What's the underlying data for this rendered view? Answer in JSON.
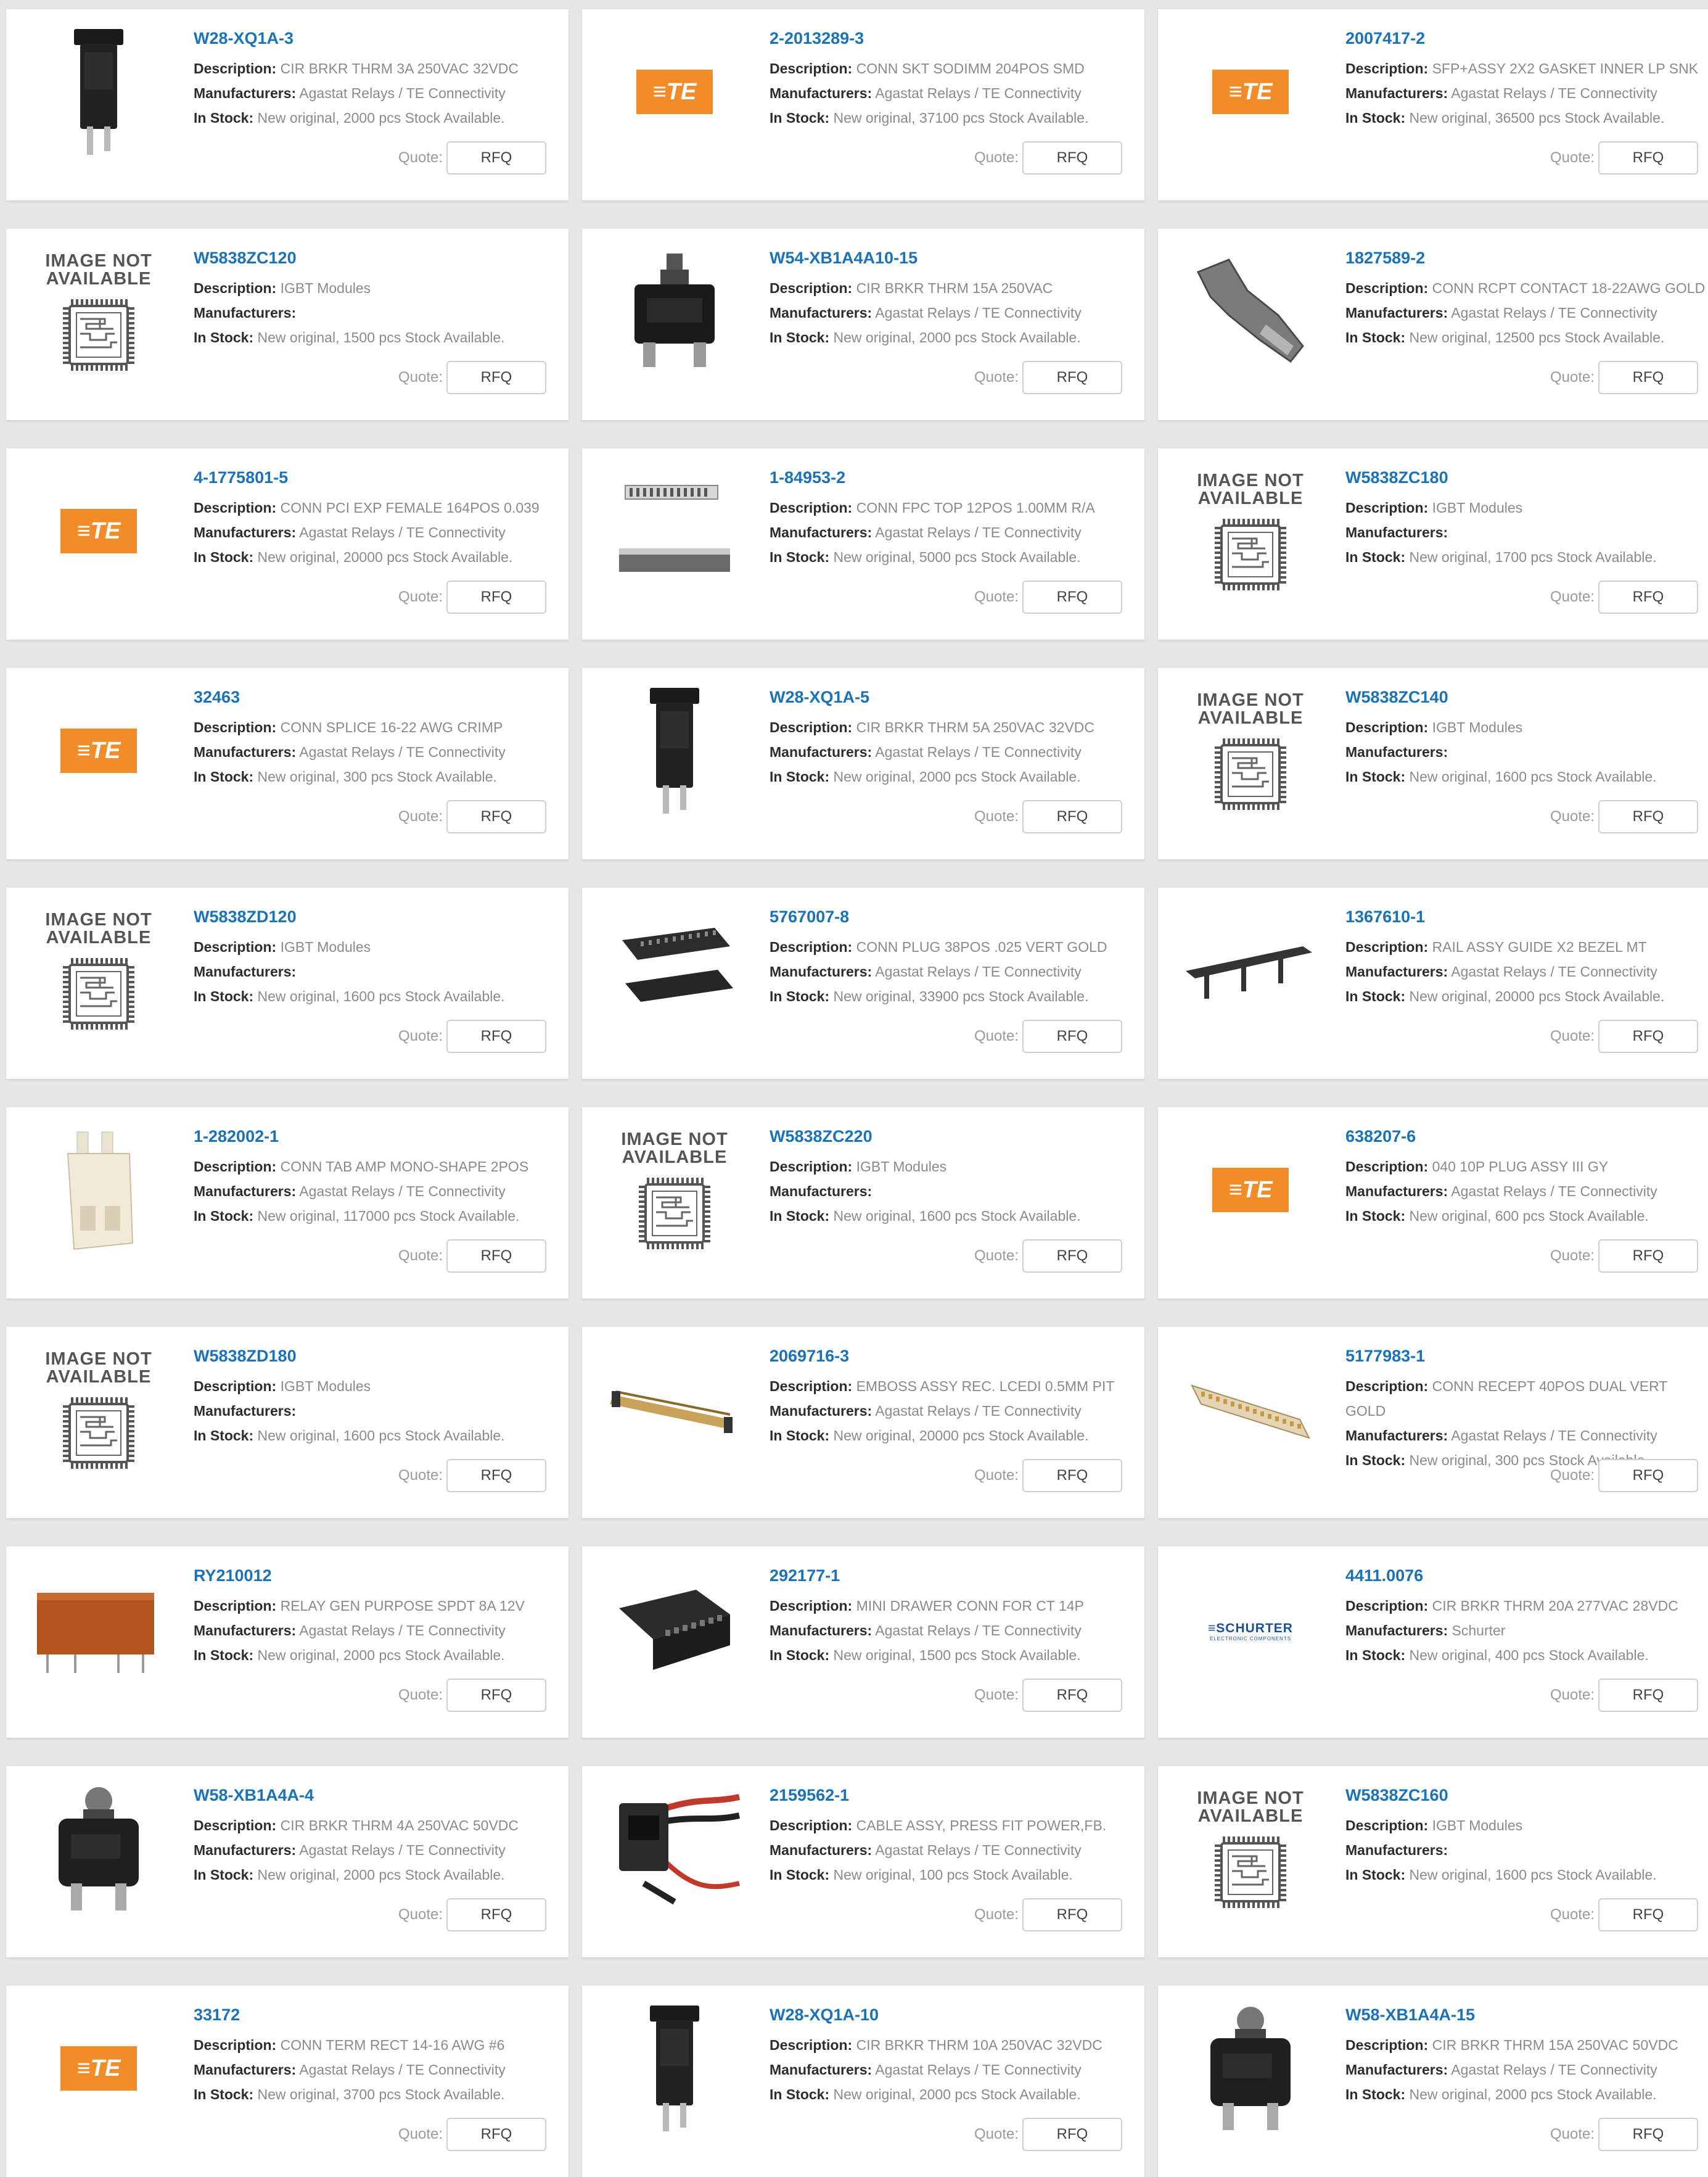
{
  "labels": {
    "description": "Description:",
    "manufacturers": "Manufacturers:",
    "in_stock": "In Stock:",
    "quote": "Quote:",
    "rfq": "RFQ"
  },
  "logo_te": "TE",
  "image_not_available": "IMAGE NOT AVAILABLE",
  "schurter_brand": "SCHURTER",
  "schurter_tag": "ELECTRONIC COMPONENTS",
  "colors": {
    "part_link": "#1a73b8",
    "te_orange": "#f28c28",
    "page_bg": "#e6e6e6"
  },
  "products": [
    {
      "part": "W28-XQ1A-3",
      "desc": "CIR BRKR THRM 3A 250VAC 32VDC",
      "mfr": "Agastat Relays / TE Connectivity",
      "stock": "New original, 2000 pcs Stock Available.",
      "image": "breaker-tall-icon"
    },
    {
      "part": "2-2013289-3",
      "desc": "CONN SKT SODIMM 204POS SMD",
      "mfr": "Agastat Relays / TE Connectivity",
      "stock": "New original, 37100 pcs Stock Available.",
      "image": "te-logo"
    },
    {
      "part": "2007417-2",
      "desc": "SFP+ASSY 2X2 GASKET INNER LP SNK",
      "mfr": "Agastat Relays / TE Connectivity",
      "stock": "New original, 36500 pcs Stock Available.",
      "image": "te-logo"
    },
    {
      "part": "W5838ZC120",
      "desc": "IGBT Modules",
      "mfr": "",
      "stock": "New original, 1500 pcs Stock Available.",
      "image": "image-not-available"
    },
    {
      "part": "W54-XB1A4A10-15",
      "desc": "CIR BRKR THRM 15A 250VAC",
      "mfr": "Agastat Relays / TE Connectivity",
      "stock": "New original, 2000 pcs Stock Available.",
      "image": "breaker-button-icon"
    },
    {
      "part": "1827589-2",
      "desc": "CONN RCPT CONTACT 18-22AWG GOLD",
      "mfr": "Agastat Relays / TE Connectivity",
      "stock": "New original, 12500 pcs Stock Available.",
      "image": "contact-icon",
      "wrap": true
    },
    {
      "part": "4-1775801-5",
      "desc": "CONN PCI EXP FEMALE 164POS 0.039",
      "mfr": "Agastat Relays / TE Connectivity",
      "stock": "New original, 20000 pcs Stock Available.",
      "image": "te-logo"
    },
    {
      "part": "1-84953-2",
      "desc": "CONN FPC TOP 12POS 1.00MM R/A",
      "mfr": "Agastat Relays / TE Connectivity",
      "stock": "New original, 5000 pcs Stock Available.",
      "image": "fpc-connector-icon"
    },
    {
      "part": "W5838ZC180",
      "desc": "IGBT Modules",
      "mfr": "",
      "stock": "New original, 1700 pcs Stock Available.",
      "image": "image-not-available"
    },
    {
      "part": "32463",
      "desc": "CONN SPLICE 16-22 AWG CRIMP",
      "mfr": "Agastat Relays / TE Connectivity",
      "stock": "New original, 300 pcs Stock Available.",
      "image": "te-logo"
    },
    {
      "part": "W28-XQ1A-5",
      "desc": "CIR BRKR THRM 5A 250VAC 32VDC",
      "mfr": "Agastat Relays / TE Connectivity",
      "stock": "New original, 2000 pcs Stock Available.",
      "image": "breaker-tall-icon"
    },
    {
      "part": "W5838ZC140",
      "desc": "IGBT Modules",
      "mfr": "",
      "stock": "New original, 1600 pcs Stock Available.",
      "image": "image-not-available"
    },
    {
      "part": "W5838ZD120",
      "desc": "IGBT Modules",
      "mfr": "",
      "stock": "New original, 1600 pcs Stock Available.",
      "image": "image-not-available"
    },
    {
      "part": "5767007-8",
      "desc": "CONN PLUG 38POS .025 VERT GOLD",
      "mfr": "Agastat Relays / TE Connectivity",
      "stock": "New original, 33900 pcs Stock Available.",
      "image": "plug-connector-icon"
    },
    {
      "part": "1367610-1",
      "desc": "RAIL ASSY GUIDE X2 BEZEL MT",
      "mfr": "Agastat Relays / TE Connectivity",
      "stock": "New original, 20000 pcs Stock Available.",
      "image": "rail-icon"
    },
    {
      "part": "1-282002-1",
      "desc": "CONN TAB AMP MONO-SHAPE 2POS",
      "mfr": "Agastat Relays / TE Connectivity",
      "stock": "New original, 117000 pcs Stock Available.",
      "image": "tab-connector-icon"
    },
    {
      "part": "W5838ZC220",
      "desc": "IGBT Modules",
      "mfr": "",
      "stock": "New original, 1600 pcs Stock Available.",
      "image": "image-not-available"
    },
    {
      "part": "638207-6",
      "desc": "040 10P PLUG ASSY III GY",
      "mfr": "Agastat Relays / TE Connectivity",
      "stock": "New original, 600 pcs Stock Available.",
      "image": "te-logo"
    },
    {
      "part": "W5838ZD180",
      "desc": "IGBT Modules",
      "mfr": "",
      "stock": "New original, 1600 pcs Stock Available.",
      "image": "image-not-available"
    },
    {
      "part": "2069716-3",
      "desc": "EMBOSS ASSY REC. LCEDI 0.5MM PIT",
      "mfr": "Agastat Relays / TE Connectivity",
      "stock": "New original, 20000 pcs Stock Available.",
      "image": "emboss-connector-icon"
    },
    {
      "part": "5177983-1",
      "desc": "CONN RECEPT 40POS DUAL VERT GOLD",
      "mfr": "Agastat Relays / TE Connectivity",
      "stock": "New original, 300 pcs Stock Available.",
      "image": "receptacle-icon",
      "wrap": true
    },
    {
      "part": "RY210012",
      "desc": "RELAY GEN PURPOSE SPDT 8A 12V",
      "mfr": "Agastat Relays / TE Connectivity",
      "stock": "New original, 2000 pcs Stock Available.",
      "image": "relay-icon"
    },
    {
      "part": "292177-1",
      "desc": "MINI DRAWER CONN FOR CT 14P",
      "mfr": "Agastat Relays / TE Connectivity",
      "stock": "New original, 1500 pcs Stock Available.",
      "image": "drawer-connector-icon"
    },
    {
      "part": "4411.0076",
      "desc": "CIR BRKR THRM 20A 277VAC 28VDC",
      "mfr": "Schurter",
      "stock": "New original, 400 pcs Stock Available.",
      "image": "schurter-logo"
    },
    {
      "part": "W58-XB1A4A-4",
      "desc": "CIR BRKR THRM 4A 250VAC 50VDC",
      "mfr": "Agastat Relays / TE Connectivity",
      "stock": "New original, 2000 pcs Stock Available.",
      "image": "breaker-round-icon"
    },
    {
      "part": "2159562-1",
      "desc": "CABLE ASSY, PRESS FIT POWER,FB.",
      "mfr": "Agastat Relays / TE Connectivity",
      "stock": "New original, 100 pcs Stock Available.",
      "image": "cable-assy-icon"
    },
    {
      "part": "W5838ZC160",
      "desc": "IGBT Modules",
      "mfr": "",
      "stock": "New original, 1600 pcs Stock Available.",
      "image": "image-not-available"
    },
    {
      "part": "33172",
      "desc": "CONN TERM RECT 14-16 AWG #6",
      "mfr": "Agastat Relays / TE Connectivity",
      "stock": "New original, 3700 pcs Stock Available.",
      "image": "te-logo"
    },
    {
      "part": "W28-XQ1A-10",
      "desc": "CIR BRKR THRM 10A 250VAC 32VDC",
      "mfr": "Agastat Relays / TE Connectivity",
      "stock": "New original, 2000 pcs Stock Available.",
      "image": "breaker-tall-icon"
    },
    {
      "part": "W58-XB1A4A-15",
      "desc": "CIR BRKR THRM 15A 250VAC 50VDC",
      "mfr": "Agastat Relays / TE Connectivity",
      "stock": "New original, 2000 pcs Stock Available.",
      "image": "breaker-round-icon"
    }
  ]
}
